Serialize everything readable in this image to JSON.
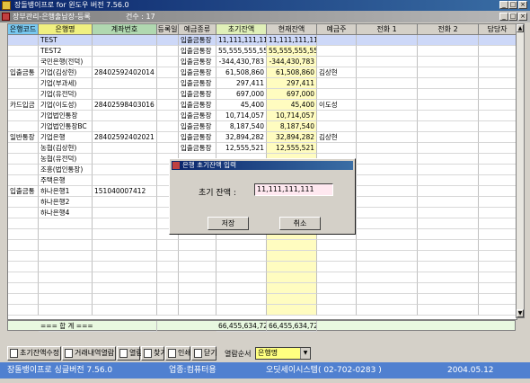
{
  "app": {
    "title": "장돌뱅이프로 for 윈도우 버전 7.56.0"
  },
  "mdi": {
    "title": "장부관리-은행출납장-등록",
    "count": "건수 : 17"
  },
  "columns": [
    "은행코드",
    "은행명",
    "계좌번호",
    "등록일",
    "예금종류",
    "초기잔액",
    "현재잔액",
    "예금주",
    "전화 1",
    "전화 2",
    "담당자"
  ],
  "rows": [
    [
      "",
      "TEST",
      "",
      "",
      "입출금통장",
      "11,111,111,111",
      "11,111,111,111",
      "",
      "",
      "",
      ""
    ],
    [
      "",
      "TEST2",
      "",
      "",
      "입출금통장",
      "55,555,555,555",
      "55,555,555,555",
      "",
      "",
      "",
      ""
    ],
    [
      "",
      "국민은행(전덕)",
      "",
      "",
      "입출금통장",
      "-344,430,783",
      "-344,430,783",
      "",
      "",
      "",
      ""
    ],
    [
      "입출금통",
      "기업(김상현)",
      "28402592402014",
      "",
      "입출금통장",
      "61,508,860",
      "61,508,860",
      "김상현",
      "",
      "",
      ""
    ],
    [
      "",
      "기업(부과세)",
      "",
      "",
      "입출금통장",
      "297,411",
      "297,411",
      "",
      "",
      "",
      ""
    ],
    [
      "",
      "기업(유전덕)",
      "",
      "",
      "입출금통장",
      "697,000",
      "697,000",
      "",
      "",
      "",
      ""
    ],
    [
      "카드입금",
      "기업(이도성)",
      "28402598403016",
      "",
      "입출금통장",
      "45,400",
      "45,400",
      "이도성",
      "",
      "",
      ""
    ],
    [
      "",
      "기업법인통장",
      "",
      "",
      "입출금통장",
      "10,714,057",
      "10,714,057",
      "",
      "",
      "",
      ""
    ],
    [
      "",
      "기업법인통장BC",
      "",
      "",
      "입출금통장",
      "8,187,540",
      "8,187,540",
      "",
      "",
      "",
      ""
    ],
    [
      "일반통장",
      "기업은행",
      "28402592402021",
      "",
      "입출금통장",
      "32,894,282",
      "32,894,282",
      "김상현",
      "",
      "",
      ""
    ],
    [
      "",
      "농협(김상현)",
      "",
      "",
      "입출금통장",
      "12,555,521",
      "12,555,521",
      "",
      "",
      "",
      ""
    ],
    [
      "",
      "농협(유전덕)",
      "",
      "",
      "",
      "",
      "",
      "",
      "",
      "",
      ""
    ],
    [
      "",
      "조흥(법인통장)",
      "",
      "",
      "",
      "",
      "",
      "",
      "",
      "",
      ""
    ],
    [
      "",
      "주택은행",
      "",
      "",
      "",
      "",
      "",
      "",
      "",
      "",
      ""
    ],
    [
      "입출금통",
      "하나은행1",
      "151040007412",
      "",
      "",
      "",
      "",
      "",
      "",
      "",
      ""
    ],
    [
      "",
      "하나은행2",
      "",
      "",
      "",
      "",
      "",
      "",
      "",
      "",
      ""
    ],
    [
      "",
      "하나은행4",
      "",
      "",
      "",
      "",
      "",
      "",
      "",
      "",
      ""
    ]
  ],
  "totals": {
    "label": "=== 합 계 ===",
    "initial": "66,455,634,724",
    "current": "66,455,634,724"
  },
  "toolbar": {
    "btn_initial": "초기잔액수정",
    "btn_history": "거래내역열람",
    "btn_print_preview": "열람",
    "btn_find": "찾기",
    "btn_print": "인쇄",
    "btn_close": "닫기",
    "sort_label": "열람순서",
    "sort_value": "은행명"
  },
  "status": {
    "left": "장돌뱅이프로 싱글버전 7.56.0",
    "mid": "업종:컴퓨터용",
    "right": "오딧세이시스템( 02-702-0283 )",
    "date": "2004.05.12"
  },
  "dialog": {
    "title": "은행 초기잔액 입력",
    "label": "초기 잔액 :",
    "value": "11,111,111,111",
    "save": "저장",
    "cancel": "취소"
  },
  "colors": {
    "title_bar": "#0a246a",
    "status_bar": "#5080d0",
    "selected_row": "#cdd8f8",
    "header_bank_code": "#78c8f0",
    "header_bank_name": "#f0f080"
  }
}
